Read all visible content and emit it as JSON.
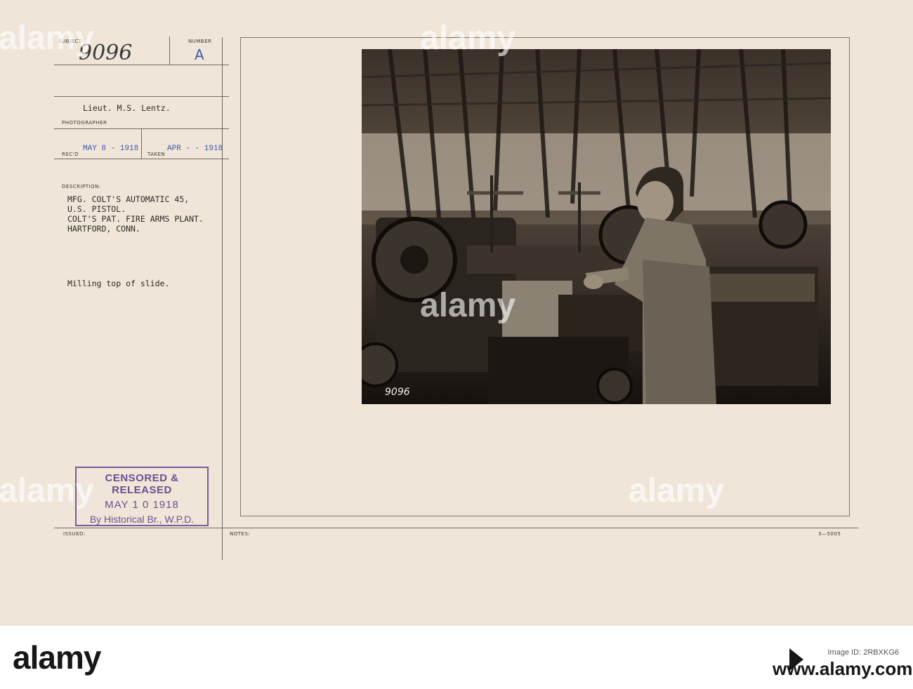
{
  "record": {
    "subject_label": "SUBJECT:",
    "subject_value": "9096",
    "number_label": "NUMBER",
    "number_value": "A",
    "photographer_name": "Lieut. M.S. Lentz.",
    "photographer_label": "PHOTOGRAPHER",
    "recd_label": "REC'D",
    "recd_value": "MAY 8 - 1918",
    "taken_label": "TAKEN",
    "taken_value": "APR - - 1918",
    "description_label": "DESCRIPTION:",
    "description_lines": [
      "MFG. COLT'S AUTOMATIC 45,",
      "U.S. PISTOL.",
      "COLT'S PAT. FIRE ARMS PLANT.",
      "HARTFORD, CONN."
    ],
    "caption": "Milling top of slide.",
    "issued_label": "ISSUED:",
    "notes_label": "NOTES:",
    "form_code": "3—5005"
  },
  "stamp": {
    "line1": "CENSORED & RELEASED",
    "line2": "MAY 1 0 1918",
    "line3": "By Historical Br., W.P.D."
  },
  "photo": {
    "negative_number": "9096"
  },
  "watermark": {
    "text": "alamy"
  },
  "footer": {
    "logo": "alamy",
    "image_id_label": "Image ID: 2RBXKG6",
    "url": "www.alamy.com"
  },
  "colors": {
    "card": "#efe6d9",
    "stamp_purple": "#6d4f8e",
    "date_blue": "#3d5aa8"
  }
}
